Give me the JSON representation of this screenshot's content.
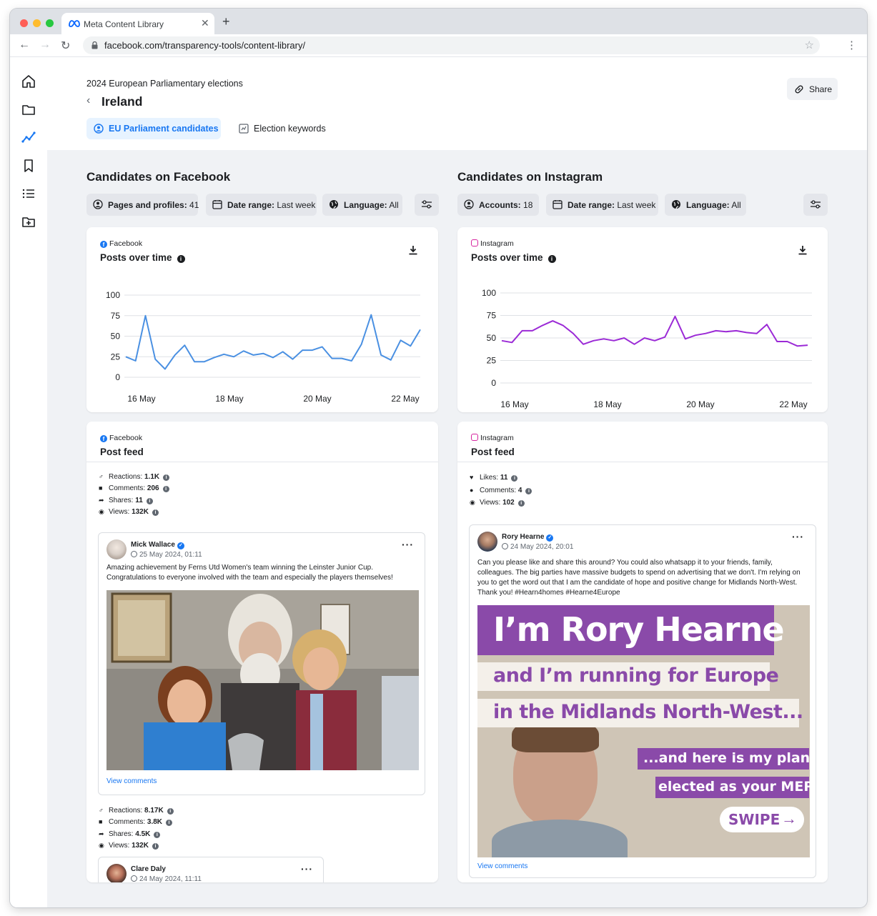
{
  "browser": {
    "tab_title": "Meta Content Library",
    "url": "facebook.com/transparency-tools/content-library/"
  },
  "sidebar": {
    "items": [
      "home-icon",
      "folder-icon",
      "analytics-icon",
      "bookmark-icon",
      "list-icon",
      "folder-add-icon"
    ]
  },
  "header": {
    "subtitle": "2024 European Parliamentary elections",
    "title": "Ireland",
    "share_label": "Share",
    "tabs": [
      {
        "label": "EU Parliament candidates",
        "active": true
      },
      {
        "label": "Election keywords",
        "active": false
      }
    ]
  },
  "facebook": {
    "section_title": "Candidates on Facebook",
    "filters": [
      {
        "key": "Pages and profiles:",
        "value": "41"
      },
      {
        "key": "Date range:",
        "value": "Last week"
      },
      {
        "key": "Language:",
        "value": "All"
      }
    ],
    "chart": {
      "platform": "Facebook",
      "title": "Posts over time"
    },
    "feed": {
      "platform": "Facebook",
      "title": "Post feed",
      "posts": [
        {
          "stats": [
            {
              "label": "Reactions:",
              "value": "1.1K"
            },
            {
              "label": "Comments:",
              "value": "206"
            },
            {
              "label": "Shares:",
              "value": "11"
            },
            {
              "label": "Views:",
              "value": "132K"
            }
          ],
          "author": "Mick Wallace",
          "time": "25 May 2024, 01:11",
          "text": "Amazing achievement by Ferns Utd Women's team winning the Leinster Junior Cup. Congratulations to everyone involved with the team and especially the players themselves!",
          "view_comments": "View comments"
        },
        {
          "stats": [
            {
              "label": "Reactions:",
              "value": "8.17K"
            },
            {
              "label": "Comments:",
              "value": "3.8K"
            },
            {
              "label": "Shares:",
              "value": "4.5K"
            },
            {
              "label": "Views:",
              "value": "132K"
            }
          ],
          "author": "Clare Daly",
          "time": "24 May 2024, 11:11"
        }
      ]
    }
  },
  "instagram": {
    "section_title": "Candidates on Instagram",
    "filters": [
      {
        "key": "Accounts:",
        "value": "18"
      },
      {
        "key": "Date range:",
        "value": "Last week"
      },
      {
        "key": "Language:",
        "value": "All"
      }
    ],
    "chart": {
      "platform": "Instagram",
      "title": "Posts over time"
    },
    "feed": {
      "platform": "Instagram",
      "title": "Post feed",
      "stats": [
        {
          "label": "Likes:",
          "value": "11"
        },
        {
          "label": "Comments:",
          "value": "4"
        },
        {
          "label": "Views:",
          "value": "102"
        }
      ],
      "post": {
        "author": "Rory Hearne",
        "time": "24 May 2024, 20:01",
        "text": "Can you please like and share this around? You could also whatsapp it to your friends, family, colleagues. The big parties have massive budgets to spend on advertising that we don't. I'm relying on you to get the word out that I am the candidate of hope and positive change for Midlands North-West. Thank you! #Hearn4homes #Hearne4Europe",
        "image_lines": [
          "I’m Rory Hearne",
          "and I’m running for Europe",
          "in the Midlands North-West...",
          "...and here is my plan if",
          "elected as your MEP",
          "SWIPE"
        ],
        "view_comments": "View comments"
      }
    }
  },
  "chart_data": [
    {
      "type": "line",
      "title": "Posts over time",
      "x_ticks": [
        "16 May",
        "18 May",
        "20 May",
        "22 May"
      ],
      "y_ticks": [
        0,
        25,
        50,
        75,
        100
      ],
      "ylim": [
        0,
        100
      ],
      "color": "#4a90e2",
      "series": [
        {
          "values": [
            25,
            20,
            75,
            22,
            10,
            27,
            39,
            19,
            19,
            24,
            28,
            25,
            32,
            27,
            29,
            24,
            31,
            22,
            33,
            33,
            37,
            23,
            23,
            20,
            40,
            76,
            27,
            21,
            45,
            38,
            58
          ]
        }
      ]
    },
    {
      "type": "line",
      "title": "Posts over time",
      "x_ticks": [
        "16 May",
        "18 May",
        "20 May",
        "22 May"
      ],
      "y_ticks": [
        0,
        25,
        50,
        75,
        100
      ],
      "ylim": [
        0,
        100
      ],
      "color": "#9b2ad6",
      "series": [
        {
          "values": [
            47,
            45,
            58,
            58,
            64,
            69,
            64,
            55,
            43,
            47,
            49,
            47,
            50,
            43,
            50,
            47,
            51,
            74,
            49,
            53,
            55,
            58,
            57,
            58,
            56,
            55,
            65,
            46,
            46,
            41,
            42
          ]
        }
      ]
    }
  ]
}
